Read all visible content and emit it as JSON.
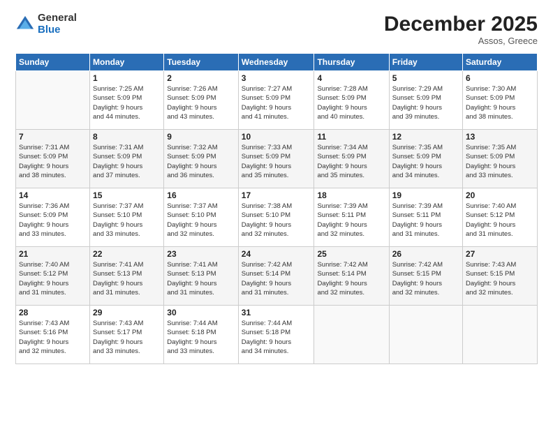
{
  "logo": {
    "general": "General",
    "blue": "Blue"
  },
  "title": "December 2025",
  "location": "Assos, Greece",
  "weekdays": [
    "Sunday",
    "Monday",
    "Tuesday",
    "Wednesday",
    "Thursday",
    "Friday",
    "Saturday"
  ],
  "weeks": [
    [
      {
        "day": "",
        "detail": ""
      },
      {
        "day": "1",
        "detail": "Sunrise: 7:25 AM\nSunset: 5:09 PM\nDaylight: 9 hours\nand 44 minutes."
      },
      {
        "day": "2",
        "detail": "Sunrise: 7:26 AM\nSunset: 5:09 PM\nDaylight: 9 hours\nand 43 minutes."
      },
      {
        "day": "3",
        "detail": "Sunrise: 7:27 AM\nSunset: 5:09 PM\nDaylight: 9 hours\nand 41 minutes."
      },
      {
        "day": "4",
        "detail": "Sunrise: 7:28 AM\nSunset: 5:09 PM\nDaylight: 9 hours\nand 40 minutes."
      },
      {
        "day": "5",
        "detail": "Sunrise: 7:29 AM\nSunset: 5:09 PM\nDaylight: 9 hours\nand 39 minutes."
      },
      {
        "day": "6",
        "detail": "Sunrise: 7:30 AM\nSunset: 5:09 PM\nDaylight: 9 hours\nand 38 minutes."
      }
    ],
    [
      {
        "day": "7",
        "detail": "Sunrise: 7:31 AM\nSunset: 5:09 PM\nDaylight: 9 hours\nand 38 minutes."
      },
      {
        "day": "8",
        "detail": "Sunrise: 7:31 AM\nSunset: 5:09 PM\nDaylight: 9 hours\nand 37 minutes."
      },
      {
        "day": "9",
        "detail": "Sunrise: 7:32 AM\nSunset: 5:09 PM\nDaylight: 9 hours\nand 36 minutes."
      },
      {
        "day": "10",
        "detail": "Sunrise: 7:33 AM\nSunset: 5:09 PM\nDaylight: 9 hours\nand 35 minutes."
      },
      {
        "day": "11",
        "detail": "Sunrise: 7:34 AM\nSunset: 5:09 PM\nDaylight: 9 hours\nand 35 minutes."
      },
      {
        "day": "12",
        "detail": "Sunrise: 7:35 AM\nSunset: 5:09 PM\nDaylight: 9 hours\nand 34 minutes."
      },
      {
        "day": "13",
        "detail": "Sunrise: 7:35 AM\nSunset: 5:09 PM\nDaylight: 9 hours\nand 33 minutes."
      }
    ],
    [
      {
        "day": "14",
        "detail": "Sunrise: 7:36 AM\nSunset: 5:09 PM\nDaylight: 9 hours\nand 33 minutes."
      },
      {
        "day": "15",
        "detail": "Sunrise: 7:37 AM\nSunset: 5:10 PM\nDaylight: 9 hours\nand 33 minutes."
      },
      {
        "day": "16",
        "detail": "Sunrise: 7:37 AM\nSunset: 5:10 PM\nDaylight: 9 hours\nand 32 minutes."
      },
      {
        "day": "17",
        "detail": "Sunrise: 7:38 AM\nSunset: 5:10 PM\nDaylight: 9 hours\nand 32 minutes."
      },
      {
        "day": "18",
        "detail": "Sunrise: 7:39 AM\nSunset: 5:11 PM\nDaylight: 9 hours\nand 32 minutes."
      },
      {
        "day": "19",
        "detail": "Sunrise: 7:39 AM\nSunset: 5:11 PM\nDaylight: 9 hours\nand 31 minutes."
      },
      {
        "day": "20",
        "detail": "Sunrise: 7:40 AM\nSunset: 5:12 PM\nDaylight: 9 hours\nand 31 minutes."
      }
    ],
    [
      {
        "day": "21",
        "detail": "Sunrise: 7:40 AM\nSunset: 5:12 PM\nDaylight: 9 hours\nand 31 minutes."
      },
      {
        "day": "22",
        "detail": "Sunrise: 7:41 AM\nSunset: 5:13 PM\nDaylight: 9 hours\nand 31 minutes."
      },
      {
        "day": "23",
        "detail": "Sunrise: 7:41 AM\nSunset: 5:13 PM\nDaylight: 9 hours\nand 31 minutes."
      },
      {
        "day": "24",
        "detail": "Sunrise: 7:42 AM\nSunset: 5:14 PM\nDaylight: 9 hours\nand 31 minutes."
      },
      {
        "day": "25",
        "detail": "Sunrise: 7:42 AM\nSunset: 5:14 PM\nDaylight: 9 hours\nand 32 minutes."
      },
      {
        "day": "26",
        "detail": "Sunrise: 7:42 AM\nSunset: 5:15 PM\nDaylight: 9 hours\nand 32 minutes."
      },
      {
        "day": "27",
        "detail": "Sunrise: 7:43 AM\nSunset: 5:15 PM\nDaylight: 9 hours\nand 32 minutes."
      }
    ],
    [
      {
        "day": "28",
        "detail": "Sunrise: 7:43 AM\nSunset: 5:16 PM\nDaylight: 9 hours\nand 32 minutes."
      },
      {
        "day": "29",
        "detail": "Sunrise: 7:43 AM\nSunset: 5:17 PM\nDaylight: 9 hours\nand 33 minutes."
      },
      {
        "day": "30",
        "detail": "Sunrise: 7:44 AM\nSunset: 5:18 PM\nDaylight: 9 hours\nand 33 minutes."
      },
      {
        "day": "31",
        "detail": "Sunrise: 7:44 AM\nSunset: 5:18 PM\nDaylight: 9 hours\nand 34 minutes."
      },
      {
        "day": "",
        "detail": ""
      },
      {
        "day": "",
        "detail": ""
      },
      {
        "day": "",
        "detail": ""
      }
    ]
  ]
}
